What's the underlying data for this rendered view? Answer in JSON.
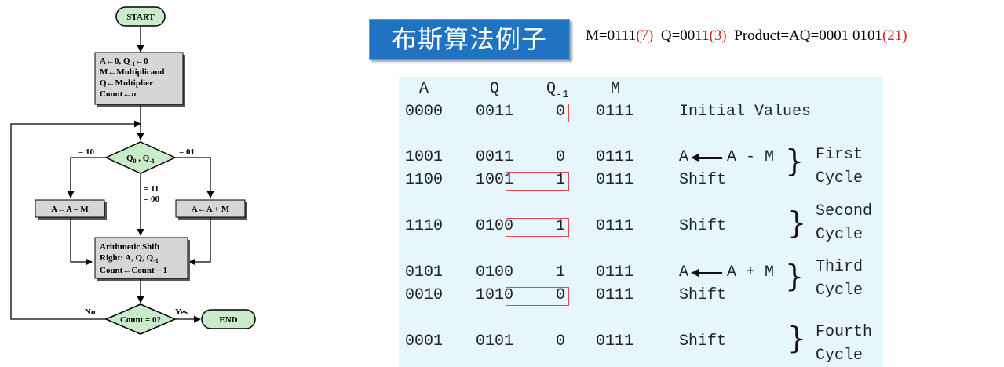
{
  "flowchart": {
    "start": "START",
    "init_lines": [
      "A←0, Q",
      "←0",
      "M←Multiplicand",
      "Q←Multiplier",
      "Count←"
    ],
    "init_n": "n",
    "init_sub": "-1",
    "decision_q": "Q",
    "decision_sub0": "0",
    "decision_comma": " , Q",
    "decision_sub1": "-1",
    "branch_10": "= 10",
    "branch_01": "= 01",
    "branch_11": "= 11",
    "branch_00": "= 00",
    "sub_box": "A←A – M",
    "add_box": "A←A + M",
    "shift_line1": "Arithmetic Shift",
    "shift_line2": "Right: A, Q, Q",
    "shift_sub": "-1",
    "shift_line3": "Count←Count – 1",
    "count_check": "Count = 0?",
    "no": "No",
    "yes": "Yes",
    "end": "END"
  },
  "title": "布斯算法例子",
  "formula": {
    "m": "M=0111",
    "m_dec": "(7)",
    "q": "Q=0011",
    "q_dec": "(3)",
    "p": "Product=AQ=0001 0101",
    "p_dec": "(21)"
  },
  "trace": {
    "headers": {
      "a": "A",
      "q": "Q",
      "q1": "Q",
      "q1_sub": "-1",
      "m": "M"
    },
    "rows": [
      {
        "a": "0000",
        "q": "0011",
        "q1": "0",
        "m": "0111",
        "op": "Initial Values"
      },
      {
        "a": "1001",
        "q": "0011",
        "q1": "0",
        "m": "0111",
        "op_left": "A",
        "op_right": "A - M"
      },
      {
        "a": "1100",
        "q": "1001",
        "q1": "1",
        "m": "0111",
        "op": "Shift"
      },
      {
        "a": "1110",
        "q": "0100",
        "q1": "1",
        "m": "0111",
        "op": "Shift"
      },
      {
        "a": "0101",
        "q": "0100",
        "q1": "1",
        "m": "0111",
        "op_left": "A",
        "op_right": "A + M"
      },
      {
        "a": "0010",
        "q": "1010",
        "q1": "0",
        "m": "0111",
        "op": "Shift"
      },
      {
        "a": "0001",
        "q": "0101",
        "q1": "0",
        "m": "0111",
        "op": "Shift"
      }
    ],
    "cycles": [
      {
        "line1": "First",
        "line2": "Cycle"
      },
      {
        "line1": "Second",
        "line2": "Cycle"
      },
      {
        "line1": "Third",
        "line2": "Cycle"
      },
      {
        "line1": "Fourth",
        "line2": "Cycle"
      }
    ],
    "colors": {
      "panel": "#e6f6fc",
      "highlight": "#e0474f"
    }
  }
}
